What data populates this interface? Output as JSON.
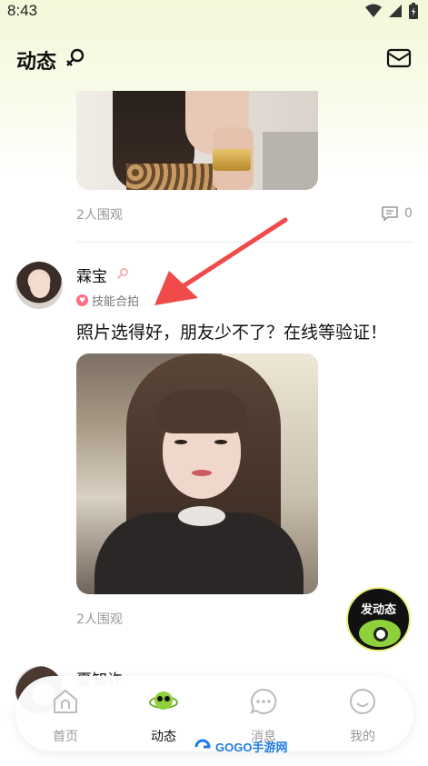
{
  "status_bar": {
    "time": "8:43"
  },
  "header": {
    "title": "动态"
  },
  "feed": {
    "post1": {
      "views": "2人围观",
      "comments": "0"
    },
    "post2": {
      "username": "霖宝",
      "tag": "技能合拍",
      "text": "照片选得好，朋友少不了？在线等验证！",
      "views": "2人围观"
    },
    "post3": {
      "username_partial": "夏知许"
    }
  },
  "fab": {
    "label": "发动态"
  },
  "nav": {
    "items": [
      {
        "label": "首页",
        "icon": "home-icon"
      },
      {
        "label": "动态",
        "icon": "planet-icon",
        "active": true
      },
      {
        "label": "消息",
        "icon": "message-icon"
      },
      {
        "label": "我的",
        "icon": "profile-smile-icon"
      }
    ]
  },
  "watermark": {
    "text": "GOGO手游网"
  },
  "colors": {
    "accent": "#e9f07a",
    "tag_heart": "#ff6b81",
    "arrow": "#f04a4a",
    "watermark": "#1f7be0"
  }
}
